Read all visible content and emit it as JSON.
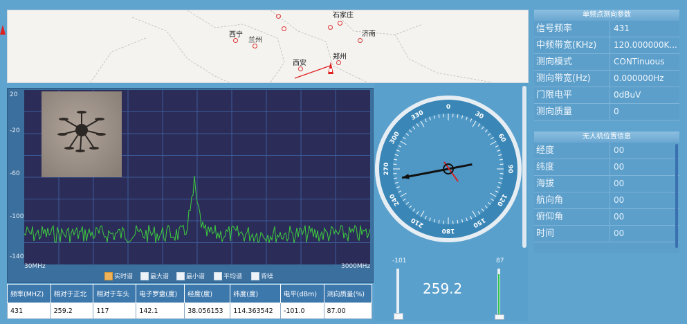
{
  "map": {
    "cities": [
      {
        "name": "石家庄"
      },
      {
        "name": "西宁"
      },
      {
        "name": "兰州"
      },
      {
        "name": "济南"
      },
      {
        "name": "西安"
      },
      {
        "name": "郑州"
      }
    ]
  },
  "spectrum": {
    "y_ticks": [
      "20",
      "-20",
      "-60",
      "-100",
      "-140"
    ],
    "x_start": "30MHz",
    "x_end": "3000MHz",
    "trace_color": "#3ecf3e",
    "checkboxes": [
      {
        "label": "实时谱",
        "checked": true
      },
      {
        "label": "最大谱",
        "checked": false
      },
      {
        "label": "最小谱",
        "checked": false
      },
      {
        "label": "平均谱",
        "checked": false
      },
      {
        "label": "背噪",
        "checked": false
      }
    ]
  },
  "table": {
    "headers": [
      "频率(MHZ)",
      "相对于正北",
      "相对于车头",
      "电子罗盘(度)",
      "经度(度)",
      "纬度(度)",
      "电平(dBm)",
      "测向质量(%)"
    ],
    "row": [
      "431",
      "259.2",
      "117",
      "142.1",
      "38.056153",
      "114.363542",
      "-101.0",
      "87.00"
    ]
  },
  "compass": {
    "ticks": [
      "0",
      "30",
      "60",
      "90",
      "120",
      "150",
      "180",
      "210",
      "240",
      "270",
      "300",
      "330"
    ],
    "bearing_deg": 259.2,
    "readout": "259.2",
    "left_slider_value": "-101",
    "right_slider_value": "87"
  },
  "params_panel": {
    "title": "单频点测向参数",
    "rows": [
      {
        "label": "信号频率",
        "value": "431"
      },
      {
        "label": "中频带宽(KHz)",
        "value": "120.000000K..."
      },
      {
        "label": "测向模式",
        "value": "CONTinuous"
      },
      {
        "label": "测向带宽(Hz)",
        "value": "0.000000Hz"
      },
      {
        "label": "门限电平",
        "value": "0dBuV"
      },
      {
        "label": "测向质量",
        "value": "0"
      }
    ]
  },
  "uav_panel": {
    "title": "无人机位置信息",
    "rows": [
      {
        "label": "经度",
        "value": "00"
      },
      {
        "label": "纬度",
        "value": "00"
      },
      {
        "label": "海拔",
        "value": "00"
      },
      {
        "label": "航向角",
        "value": "00"
      },
      {
        "label": "俯仰角",
        "value": "00"
      },
      {
        "label": "时间",
        "value": "00"
      }
    ]
  }
}
